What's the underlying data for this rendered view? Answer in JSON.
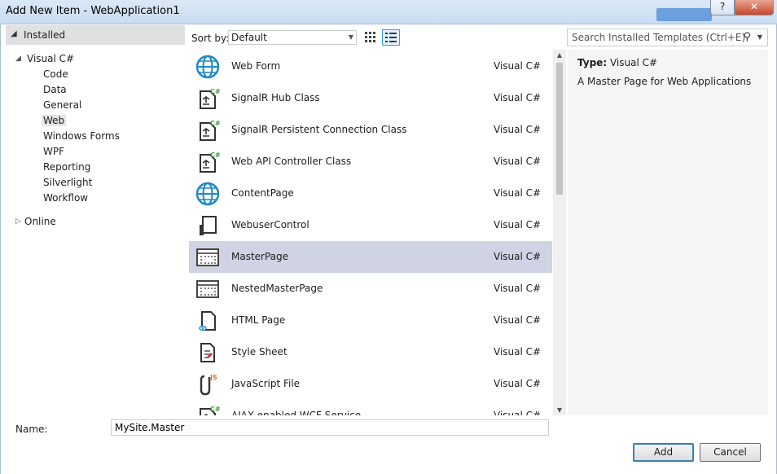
{
  "window": {
    "title": "Add New Item - WebApplication1",
    "help_label": "?",
    "close_label": "✕"
  },
  "tree": {
    "installed_label": "Installed",
    "root": {
      "label": "Visual C#"
    },
    "children": [
      "Code",
      "Data",
      "General",
      "Web",
      "Windows Forms",
      "WPF",
      "Reporting",
      "Silverlight",
      "Workflow"
    ],
    "selected": "Web",
    "online_label": "Online"
  },
  "toolbar": {
    "sort_label": "Sort by:",
    "sort_value": "Default",
    "search_placeholder": "Search Installed Templates (Ctrl+E)"
  },
  "templates": [
    {
      "name": "Web Form",
      "lang": "Visual C#",
      "icon": "globe-icon"
    },
    {
      "name": "SignalR Hub Class",
      "lang": "Visual C#",
      "icon": "csharp-class-icon"
    },
    {
      "name": "SignalR Persistent Connection Class",
      "lang": "Visual C#",
      "icon": "csharp-class-icon"
    },
    {
      "name": "Web API Controller Class",
      "lang": "Visual C#",
      "icon": "csharp-class-icon"
    },
    {
      "name": "ContentPage",
      "lang": "Visual C#",
      "icon": "globe-icon"
    },
    {
      "name": "WebuserControl",
      "lang": "Visual C#",
      "icon": "user-control-icon"
    },
    {
      "name": "MasterPage",
      "lang": "Visual C#",
      "icon": "master-page-icon"
    },
    {
      "name": "NestedMasterPage",
      "lang": "Visual C#",
      "icon": "master-page-icon"
    },
    {
      "name": "HTML Page",
      "lang": "Visual C#",
      "icon": "html-page-icon"
    },
    {
      "name": "Style Sheet",
      "lang": "Visual C#",
      "icon": "stylesheet-icon"
    },
    {
      "name": "JavaScript File",
      "lang": "Visual C#",
      "icon": "javascript-file-icon"
    },
    {
      "name": "AJAX-enabled WCF Service",
      "lang": "Visual C#",
      "icon": "csharp-class-icon"
    }
  ],
  "selected_template": "MasterPage",
  "info": {
    "type_label": "Type:",
    "type_value": "Visual C#",
    "description": "A Master Page for Web Applications"
  },
  "footer": {
    "name_label": "Name:",
    "name_value": "MySite.Master",
    "add_label": "Add",
    "cancel_label": "Cancel"
  },
  "colors": {
    "selected_row": "#cfd3e3",
    "globe": "#1e88c8",
    "csharp_badge": "#3a9a3a",
    "js_badge": "#e0701e"
  }
}
